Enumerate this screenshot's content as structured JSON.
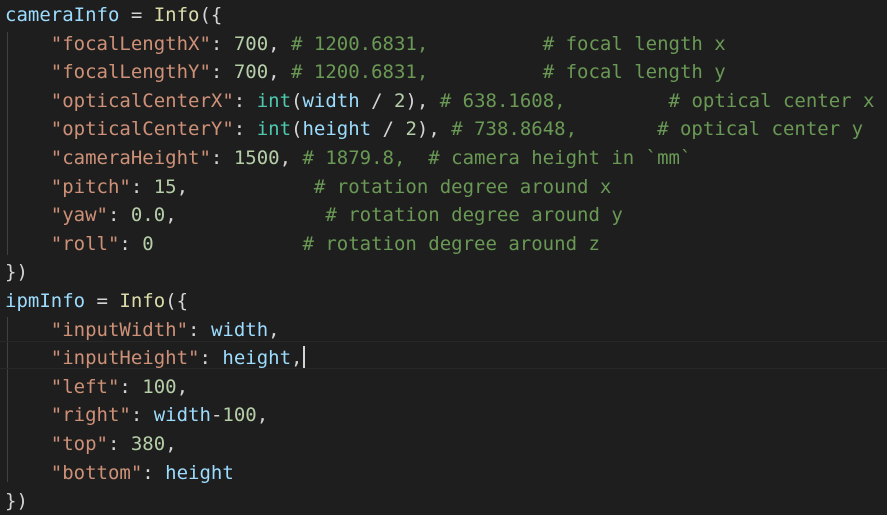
{
  "editor": {
    "theme": {
      "background": "#1e1e1e",
      "foreground": "#d4d4d4"
    },
    "lines": [
      [
        [
          "var",
          "cameraInfo"
        ],
        [
          "pl",
          " = "
        ],
        [
          "fn",
          "Info"
        ],
        [
          "pl",
          "({"
        ]
      ],
      [
        [
          "pl",
          "    "
        ],
        [
          "str",
          "\"focalLengthX\""
        ],
        [
          "pl",
          ": "
        ],
        [
          "num",
          "700"
        ],
        [
          "pl",
          ", "
        ],
        [
          "com",
          "# 1200.6831,          # focal length x"
        ]
      ],
      [
        [
          "pl",
          "    "
        ],
        [
          "str",
          "\"focalLengthY\""
        ],
        [
          "pl",
          ": "
        ],
        [
          "num",
          "700"
        ],
        [
          "pl",
          ", "
        ],
        [
          "com",
          "# 1200.6831,          # focal length y"
        ]
      ],
      [
        [
          "pl",
          "    "
        ],
        [
          "str",
          "\"opticalCenterX\""
        ],
        [
          "pl",
          ": "
        ],
        [
          "bi",
          "int"
        ],
        [
          "pl",
          "("
        ],
        [
          "var",
          "width"
        ],
        [
          "pl",
          " / "
        ],
        [
          "num",
          "2"
        ],
        [
          "pl",
          "), "
        ],
        [
          "com",
          "# 638.1608,         # optical center x"
        ]
      ],
      [
        [
          "pl",
          "    "
        ],
        [
          "str",
          "\"opticalCenterY\""
        ],
        [
          "pl",
          ": "
        ],
        [
          "bi",
          "int"
        ],
        [
          "pl",
          "("
        ],
        [
          "var",
          "height"
        ],
        [
          "pl",
          " / "
        ],
        [
          "num",
          "2"
        ],
        [
          "pl",
          "), "
        ],
        [
          "com",
          "# 738.8648,       # optical center y"
        ]
      ],
      [
        [
          "pl",
          "    "
        ],
        [
          "str",
          "\"cameraHeight\""
        ],
        [
          "pl",
          ": "
        ],
        [
          "num",
          "1500"
        ],
        [
          "pl",
          ", "
        ],
        [
          "com",
          "# 1879.8,  # camera height in `mm`"
        ]
      ],
      [
        [
          "pl",
          "    "
        ],
        [
          "str",
          "\"pitch\""
        ],
        [
          "pl",
          ": "
        ],
        [
          "num",
          "15"
        ],
        [
          "pl",
          ",           "
        ],
        [
          "com",
          "# rotation degree around x"
        ]
      ],
      [
        [
          "pl",
          "    "
        ],
        [
          "str",
          "\"yaw\""
        ],
        [
          "pl",
          ": "
        ],
        [
          "num",
          "0.0"
        ],
        [
          "pl",
          ",             "
        ],
        [
          "com",
          "# rotation degree around y"
        ]
      ],
      [
        [
          "pl",
          "    "
        ],
        [
          "str",
          "\"roll\""
        ],
        [
          "pl",
          ": "
        ],
        [
          "num",
          "0"
        ],
        [
          "pl",
          "             "
        ],
        [
          "com",
          "# rotation degree around z"
        ]
      ],
      [
        [
          "pl",
          "})"
        ]
      ],
      [
        [
          "var",
          "ipmInfo"
        ],
        [
          "pl",
          " = "
        ],
        [
          "fn",
          "Info"
        ],
        [
          "pl",
          "({"
        ]
      ],
      [
        [
          "pl",
          "    "
        ],
        [
          "str",
          "\"inputWidth\""
        ],
        [
          "pl",
          ": "
        ],
        [
          "var",
          "width"
        ],
        [
          "pl",
          ","
        ]
      ],
      [
        [
          "pl",
          "    "
        ],
        [
          "str",
          "\"inputHeight\""
        ],
        [
          "pl",
          ": "
        ],
        [
          "var",
          "height"
        ],
        [
          "pl",
          ","
        ]
      ],
      [
        [
          "pl",
          "    "
        ],
        [
          "str",
          "\"left\""
        ],
        [
          "pl",
          ": "
        ],
        [
          "num",
          "100"
        ],
        [
          "pl",
          ","
        ]
      ],
      [
        [
          "pl",
          "    "
        ],
        [
          "str",
          "\"right\""
        ],
        [
          "pl",
          ": "
        ],
        [
          "var",
          "width"
        ],
        [
          "pl",
          "-"
        ],
        [
          "num",
          "100"
        ],
        [
          "pl",
          ","
        ]
      ],
      [
        [
          "pl",
          "    "
        ],
        [
          "str",
          "\"top\""
        ],
        [
          "pl",
          ": "
        ],
        [
          "num",
          "380"
        ],
        [
          "pl",
          ","
        ]
      ],
      [
        [
          "pl",
          "    "
        ],
        [
          "str",
          "\"bottom\""
        ],
        [
          "pl",
          ": "
        ],
        [
          "var",
          "height"
        ]
      ],
      [
        [
          "pl",
          "})"
        ]
      ]
    ],
    "current_line": 12
  }
}
